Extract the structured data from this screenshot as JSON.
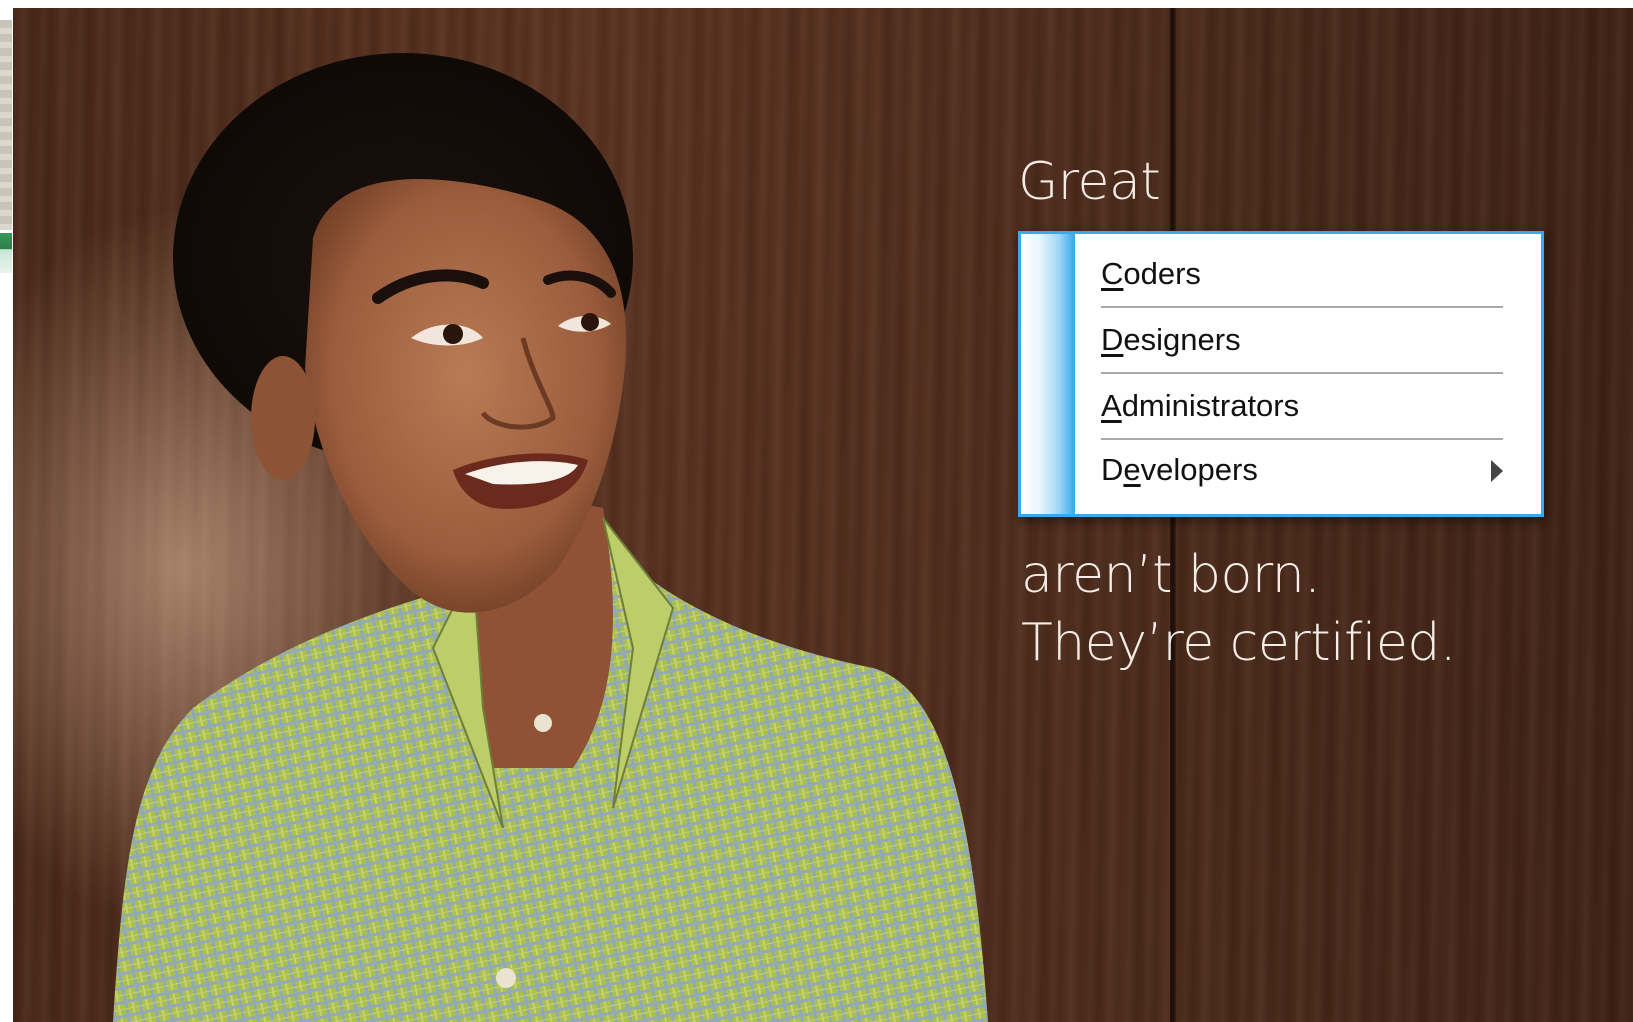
{
  "ad": {
    "headline_top": "Great",
    "headline_middle": "aren’t born.",
    "headline_bottom": "They’re certified."
  },
  "menu": {
    "items": [
      {
        "label": "Coders",
        "mnemonic": "C",
        "rest": "oders",
        "prefix": ""
      },
      {
        "label": "Designers",
        "mnemonic": "D",
        "rest": "esigners",
        "prefix": ""
      },
      {
        "label": "Administrators",
        "mnemonic": "A",
        "rest": "dministrators",
        "prefix": ""
      },
      {
        "label": "Developers",
        "mnemonic": "e",
        "rest": "velopers",
        "prefix": "D",
        "has_submenu": true
      }
    ],
    "accent_color": "#3aa9e8"
  },
  "icons": {
    "submenu": "chevron-right-icon"
  }
}
